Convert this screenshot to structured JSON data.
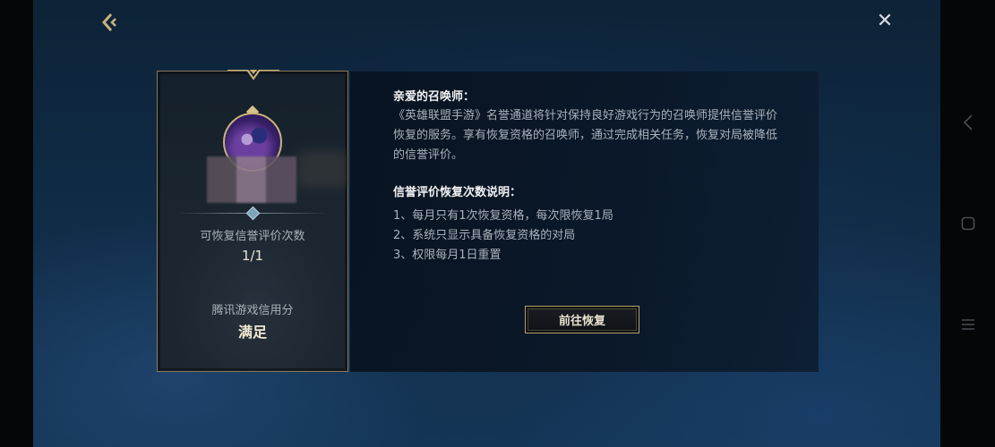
{
  "icons": {
    "back": "chevron-left-icon",
    "close": "close-icon"
  },
  "header": {
    "close_glyph": "✕"
  },
  "card": {
    "restore_count_label": "可恢复信誉评价次数",
    "restore_count_value": "1/1",
    "credit_label": "腾讯游戏信用分",
    "credit_value": "满足"
  },
  "panel": {
    "greeting": "亲爱的召唤师：",
    "intro": "《英雄联盟手游》名誉通道将针对保持良好游戏行为的召唤师提供信誉评价恢复的服务。享有恢复资格的召唤师，通过完成相关任务，恢复对局被降低的信誉评价。",
    "rules_title": "信誉评价恢复次数说明：",
    "rules": [
      "1、每月只有1次恢复资格，每次限恢复1局",
      "2、系统只显示具备恢复资格的对局",
      "3、权限每月1日重置"
    ],
    "go_button": "前往恢复"
  },
  "colors": {
    "accent_gold": "#b9a36b",
    "background_blue": "#0f2a44"
  }
}
